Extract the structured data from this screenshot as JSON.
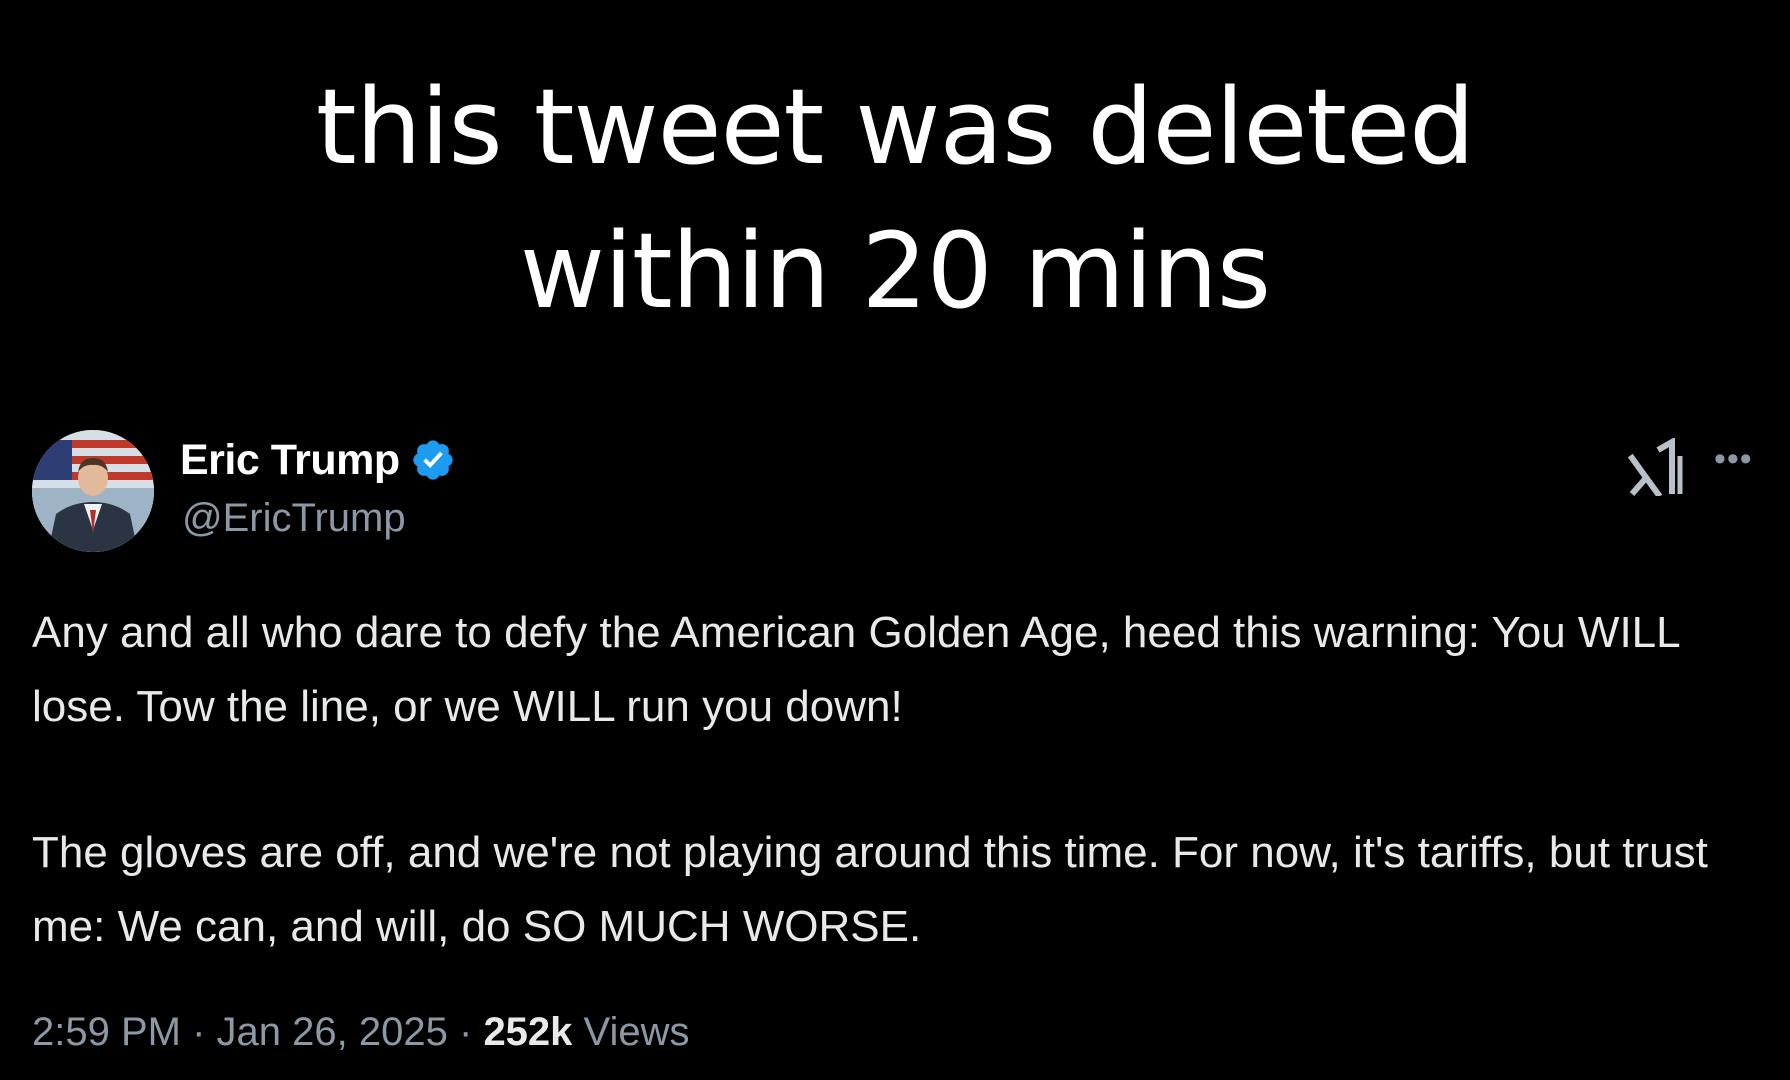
{
  "caption": {
    "line1": "this tweet was deleted",
    "line2": "within 20 mins"
  },
  "tweet": {
    "author": {
      "display_name": "Eric Trump",
      "handle": "@EricTrump",
      "verified": true,
      "verified_color": "#1d9bf0"
    },
    "paragraphs": [
      "Any and all who dare to defy the American Golden Age, heed this warning: You WILL lose. Tow the line, or we WILL run you down!",
      "The gloves are off, and we're not playing around this time. For now, it's tariffs, but trust me: We can, and will, do SO MUCH WORSE."
    ],
    "time": "2:59 PM",
    "separator": "·",
    "date": "Jan 26, 2025",
    "views_count": "252k",
    "views_label": "Views"
  },
  "icons": {
    "platform": "x-logo-icon",
    "more": "more-options-icon",
    "verified": "verified-badge-icon"
  },
  "colors": {
    "background": "#000000",
    "text_primary": "#e7e9ea",
    "text_secondary": "#8b98a5"
  }
}
